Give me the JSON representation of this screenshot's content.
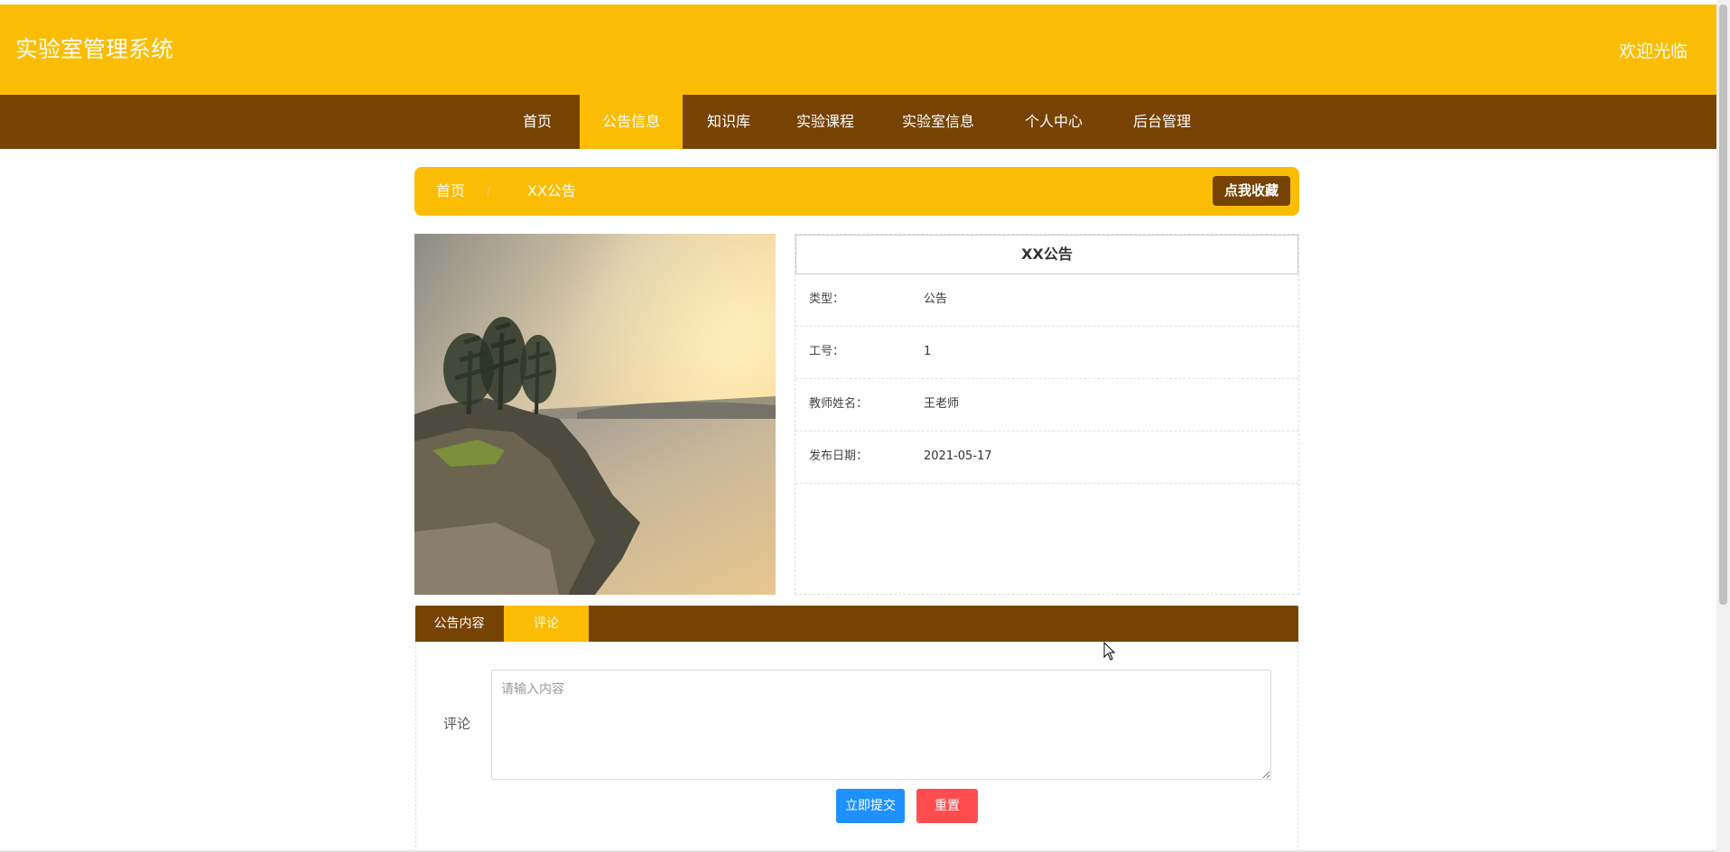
{
  "header": {
    "title": "实验室管理系统",
    "welcome": "欢迎光临"
  },
  "nav": {
    "items": [
      {
        "label": "首页"
      },
      {
        "label": "公告信息"
      },
      {
        "label": "知识库"
      },
      {
        "label": "实验课程"
      },
      {
        "label": "实验室信息"
      },
      {
        "label": "个人中心"
      },
      {
        "label": "后台管理"
      }
    ],
    "active_index": 1
  },
  "breadcrumb": {
    "home": "首页",
    "separator": "/",
    "current": "XX公告",
    "favorite_label": "点我收藏"
  },
  "detail": {
    "title": "XX公告",
    "fields": [
      {
        "label": "类型：",
        "value": "公告"
      },
      {
        "label": "工号：",
        "value": "1"
      },
      {
        "label": "教师姓名：",
        "value": "王老师"
      },
      {
        "label": "发布日期：",
        "value": "2021-05-17"
      }
    ]
  },
  "tabs": [
    {
      "label": "公告内容"
    },
    {
      "label": "评论"
    }
  ],
  "active_tab": 1,
  "comment": {
    "label": "评论",
    "placeholder": "请输入内容",
    "value": "",
    "submit_label": "立即提交",
    "reset_label": "重置"
  },
  "colors": {
    "primary_yellow": "#FBBC04",
    "primary_brown": "#774304",
    "submit_blue": "#1E90FF",
    "reset_red": "#FF4D4F"
  },
  "icons": {
    "photo": "landscape-photo",
    "cursor": "mouse-pointer-icon"
  }
}
